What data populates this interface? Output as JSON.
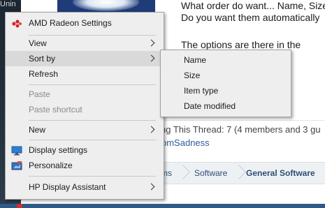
{
  "background": {
    "left_fragment": "Unin",
    "post_line1": "What order do want... Name, Size",
    "post_line2": "Do you want them automatically",
    "post_line3": "The options are there in the",
    "viewing_thread": "ng This Thread: 7 (4 members and 3 gu",
    "username": "omSadness",
    "breadcrumbs": [
      "ms",
      "Software",
      "General Software"
    ]
  },
  "context_menu": {
    "items": [
      {
        "label": "AMD Radeon Settings",
        "icon": "amd-radeon-icon"
      },
      {
        "label": "View"
      },
      {
        "label": "Sort by"
      },
      {
        "label": "Refresh"
      },
      {
        "label": "Paste"
      },
      {
        "label": "Paste shortcut"
      },
      {
        "label": "New"
      },
      {
        "label": "Display settings",
        "icon": "display-icon"
      },
      {
        "label": "Personalize",
        "icon": "personalize-icon"
      },
      {
        "label": "HP Display Assistant"
      }
    ]
  },
  "sort_submenu": {
    "items": [
      "Name",
      "Size",
      "Item type",
      "Date modified"
    ]
  },
  "colors": {
    "menu_bg": "#eeeeee",
    "menu_highlight": "#d9d9d9",
    "disabled_text": "#8a8a8a",
    "amd_red": "#d8242c",
    "link_blue": "#2e5c9a"
  }
}
